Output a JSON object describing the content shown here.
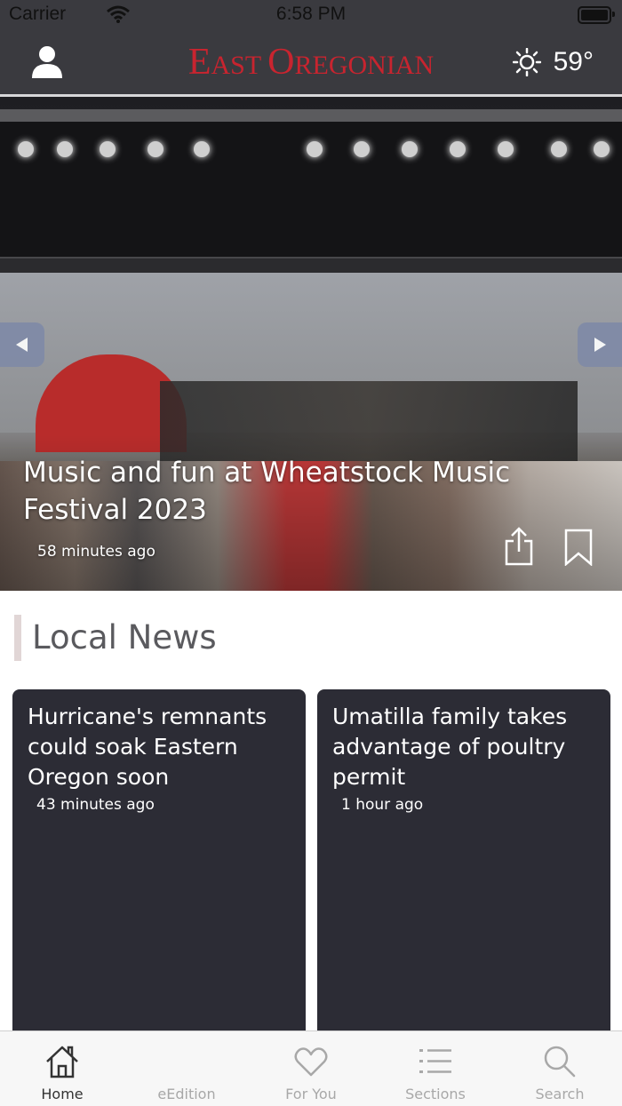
{
  "status_bar": {
    "carrier": "Carrier",
    "time": "6:58 PM"
  },
  "header": {
    "logo": {
      "part1_big": "E",
      "part1_rest": "AST ",
      "part2_big": "O",
      "part2_rest": "REGONIAN"
    },
    "weather": {
      "temperature": "59°",
      "icon": "sun-icon"
    }
  },
  "hero": {
    "title": "Music and fun at Wheatstock Music Festival 2023",
    "time_ago": "58 minutes ago"
  },
  "local_news": {
    "heading": "Local News",
    "cards": [
      {
        "title": "Hurricane's remnants could soak Eastern Oregon soon",
        "time_ago": "43 minutes ago"
      },
      {
        "title": "Umatilla family takes advantage of poultry permit",
        "time_ago": "1 hour ago"
      }
    ]
  },
  "tab_bar": {
    "tabs": [
      {
        "label": "Home",
        "icon": "home-icon",
        "active": true
      },
      {
        "label": "eEdition",
        "icon": "",
        "active": false
      },
      {
        "label": "For You",
        "icon": "heart-icon",
        "active": false
      },
      {
        "label": "Sections",
        "icon": "list-icon",
        "active": false
      },
      {
        "label": "Search",
        "icon": "search-icon",
        "active": false
      }
    ]
  },
  "colors": {
    "brand_red": "#c8242f",
    "header_bg": "#3a3a3f",
    "card_bg": "#2c2c35",
    "arrow_bg": "#7f8aa7"
  }
}
